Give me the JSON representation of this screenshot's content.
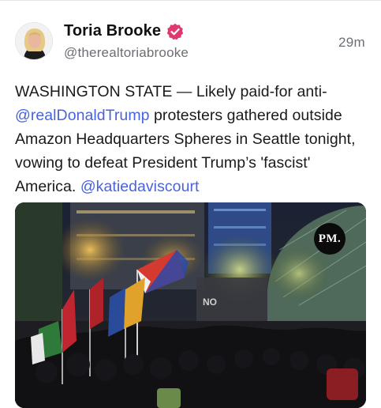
{
  "post": {
    "author": {
      "display_name": "Toria Brooke",
      "handle": "@therealtoriabrooke",
      "verified": true,
      "avatar_icon": "profile-photo"
    },
    "timestamp": "29m",
    "text_segments": [
      {
        "text": "WASHINGTON STATE — Likely paid-for anti-",
        "type": "text"
      },
      {
        "text": "@realDonaldTrump",
        "type": "mention"
      },
      {
        "text": " protesters gathered outside Amazon Headquarters Spheres in Seattle tonight, vowing to defeat President Trump’s 'fascist' America. ",
        "type": "text"
      },
      {
        "text": "@katiedaviscourt",
        "type": "mention"
      }
    ],
    "media": {
      "type": "video-thumbnail",
      "badge": "PM."
    }
  },
  "colors": {
    "mention": "#4a63d8",
    "verified_badge": "#e0386e",
    "secondary_text": "#6b6f74"
  }
}
